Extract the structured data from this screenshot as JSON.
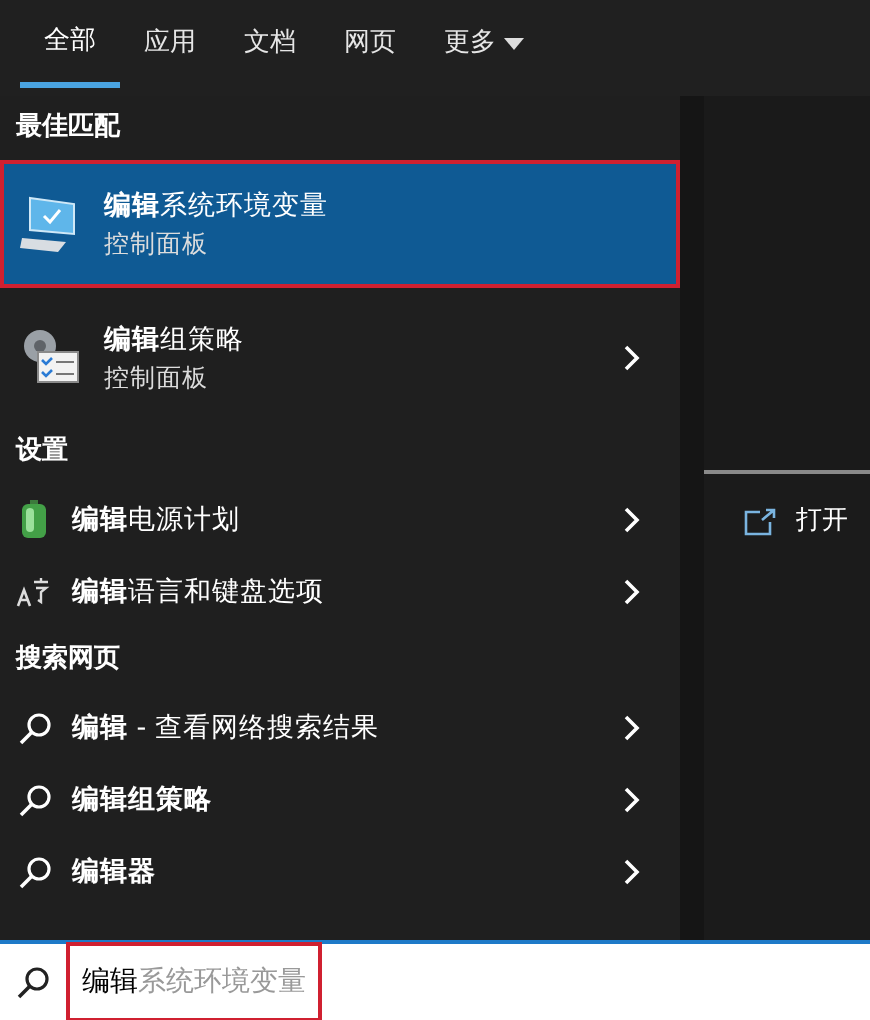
{
  "tabs": [
    {
      "label": "全部",
      "selected": true
    },
    {
      "label": "应用",
      "selected": false
    },
    {
      "label": "文档",
      "selected": false
    },
    {
      "label": "网页",
      "selected": false
    },
    {
      "label": "更多",
      "selected": false,
      "dropdown": true
    }
  ],
  "sections": [
    {
      "title": "最佳匹配",
      "items": [
        {
          "kind": "app",
          "title": "**编辑**系统环境变量",
          "subtitle": "控制面板",
          "selected": true,
          "annotated": true,
          "chevron": false
        }
      ]
    },
    {
      "items": [
        {
          "kind": "app",
          "title": "**编辑**组策略",
          "subtitle": "控制面板",
          "selected": false,
          "annotated": false,
          "chevron": true
        }
      ]
    },
    {
      "title": "设置",
      "items": [
        {
          "kind": "setting",
          "title": "**编辑**电源计划",
          "selected": false,
          "annotated": false,
          "chevron": true
        },
        {
          "kind": "setting",
          "title": "**编辑**语言和键盘选项",
          "selected": false,
          "annotated": false,
          "chevron": true
        }
      ]
    },
    {
      "title": "搜索网页",
      "items": [
        {
          "kind": "web",
          "title": "**编辑** - 查看网络搜索结果",
          "selected": false,
          "annotated": false,
          "chevron": true
        },
        {
          "kind": "web",
          "title": "**编辑组策略**",
          "selected": false,
          "annotated": false,
          "chevron": true
        },
        {
          "kind": "web",
          "title": "**编辑器**",
          "selected": false,
          "annotated": false,
          "chevron": true
        }
      ]
    }
  ],
  "preview": {
    "actions": [
      {
        "label": "打开"
      }
    ]
  },
  "search": {
    "value": "编辑",
    "suggestion": "系统环境变量",
    "annotated": true
  }
}
